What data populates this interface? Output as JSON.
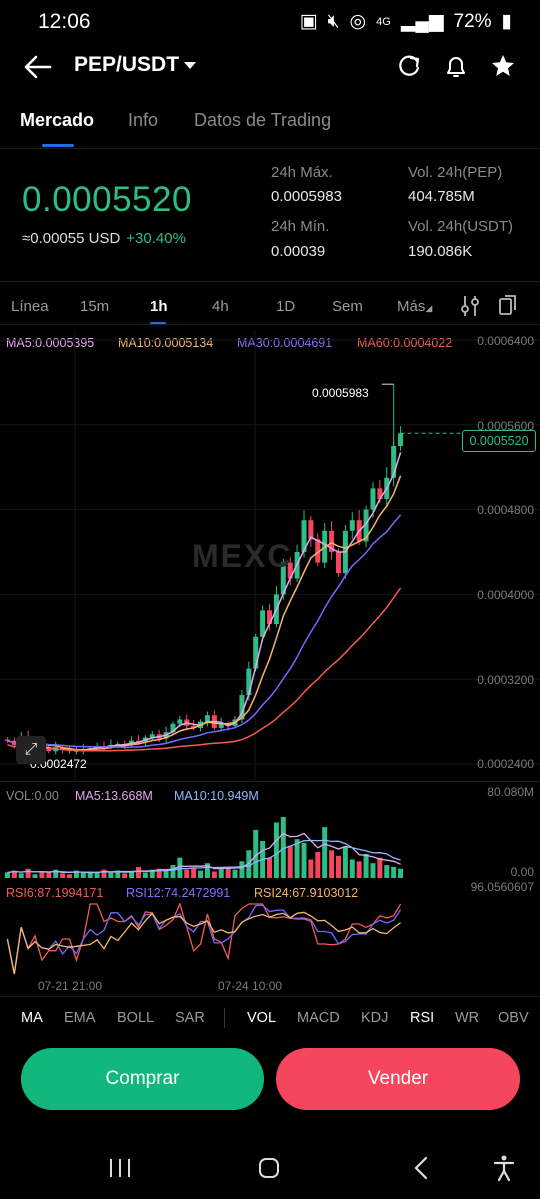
{
  "status_bar": {
    "time": "12:06",
    "battery": "72%",
    "network": "4G"
  },
  "header": {
    "pair": "PEP/USDT"
  },
  "tabs": [
    {
      "label": "Mercado",
      "active": true
    },
    {
      "label": "Info",
      "active": false
    },
    {
      "label": "Datos de Trading",
      "active": false
    }
  ],
  "market": {
    "price": "0.0005520",
    "usd_equiv": "≈0.00055 USD",
    "change_pct": "+30.40%",
    "high_label": "24h Máx.",
    "high_value": "0.0005983",
    "low_label": "24h Mín.",
    "low_value": "0.00039",
    "vol_base_label": "Vol. 24h(PEP)",
    "vol_base_value": "404.785M",
    "vol_quote_label": "Vol. 24h(USDT)",
    "vol_quote_value": "190.086K"
  },
  "timeframes": [
    {
      "label": "Línea"
    },
    {
      "label": "15m"
    },
    {
      "label": "1h",
      "active": true
    },
    {
      "label": "4h"
    },
    {
      "label": "1D"
    },
    {
      "label": "Sem"
    },
    {
      "label": "Más"
    }
  ],
  "ma_legend": {
    "ma5": "MA5:0.0005395",
    "ma10": "MA10:0.0005134",
    "ma30": "MA30:0.0004691",
    "ma60": "MA60:0.0004022"
  },
  "chart_data": {
    "type": "candlestick",
    "y_axis_labels": [
      "0.0006400",
      "0.0005600",
      "0.0004800",
      "0.0004000",
      "0.0003200",
      "0.0002400"
    ],
    "ylim": [
      0.00024,
      0.00064
    ],
    "max_label": "0.0005983",
    "min_label": "0.0002472",
    "last_label": "0.0005520",
    "watermark": "MEXC",
    "colors": {
      "up": "#2ebd85",
      "down": "#f6465d",
      "ma5": "#e7a7f0",
      "ma10": "#f5b56b",
      "ma30": "#7667ff",
      "ma60": "#f25c54"
    },
    "close_series": [
      0.000262,
      0.000258,
      0.000266,
      0.000256,
      0.00026,
      0.000254,
      0.000252,
      0.000256,
      0.000254,
      0.000252,
      0.000253,
      0.000254,
      0.000255,
      0.000257,
      0.000256,
      0.000258,
      0.000259,
      0.000258,
      0.000262,
      0.000261,
      0.000265,
      0.000268,
      0.000264,
      0.00027,
      0.000278,
      0.000282,
      0.000276,
      0.000274,
      0.00028,
      0.000286,
      0.000274,
      0.000278,
      0.000276,
      0.000282,
      0.000305,
      0.00033,
      0.00036,
      0.000385,
      0.000372,
      0.0004,
      0.00043,
      0.000415,
      0.00044,
      0.00047,
      0.000452,
      0.00043,
      0.00046,
      0.00044,
      0.00042,
      0.00046,
      0.00047,
      0.00045,
      0.00048,
      0.0005,
      0.00049,
      0.00051,
      0.00054,
      0.000552
    ],
    "volume_legend": {
      "vol": "VOL:0.00",
      "ma5": "MA5:13.668M",
      "ma10": "MA10:10.949M"
    },
    "volume_axis": [
      "80.080M",
      "0.00"
    ],
    "volume_series": [
      6,
      8,
      5,
      10,
      4,
      7,
      6,
      9,
      5,
      4,
      8,
      6,
      5,
      7,
      9,
      6,
      8,
      5,
      7,
      12,
      6,
      9,
      10,
      8,
      14,
      22,
      9,
      11,
      8,
      16,
      7,
      10,
      12,
      9,
      18,
      30,
      52,
      40,
      22,
      60,
      66,
      35,
      42,
      38,
      20,
      28,
      55,
      30,
      24,
      34,
      20,
      18,
      26,
      16,
      22,
      14,
      12,
      10
    ],
    "rsi_legend": {
      "rsi6": "RSI6:87.1994171",
      "rsi12": "RSI12:74.2472991",
      "rsi24": "RSI24:67.9103012"
    },
    "rsi_axis": [
      "96.0560607"
    ],
    "time_labels": [
      "07-21 21:00",
      "07-24 10:00"
    ]
  },
  "indicators_main": [
    {
      "label": "MA",
      "active": true
    },
    {
      "label": "EMA"
    },
    {
      "label": "BOLL"
    },
    {
      "label": "SAR"
    }
  ],
  "indicators_sub": [
    {
      "label": "VOL",
      "active": true
    },
    {
      "label": "MACD"
    },
    {
      "label": "KDJ"
    },
    {
      "label": "RSI",
      "active": true
    },
    {
      "label": "WR"
    },
    {
      "label": "OBV"
    }
  ],
  "actions": {
    "buy": "Comprar",
    "sell": "Vender"
  }
}
